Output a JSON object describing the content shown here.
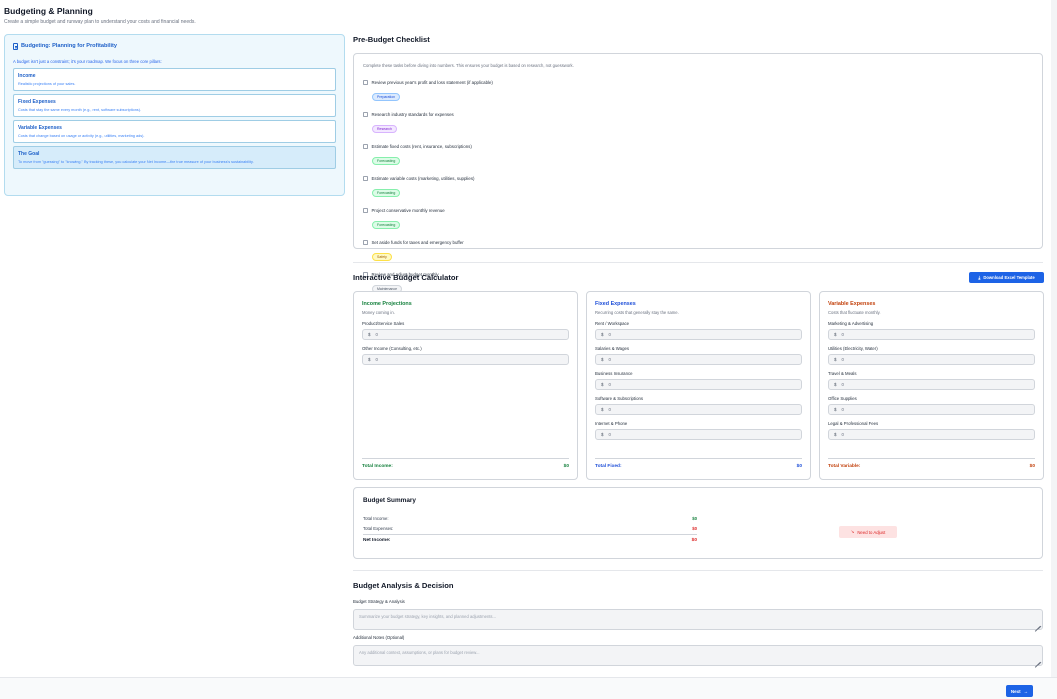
{
  "header": {
    "title": "Budgeting & Planning",
    "subtitle": "Create a simple budget and runway plan to understand your costs and financial needs."
  },
  "intro_panel": {
    "title": "Budgeting: Planning for Profitability",
    "intro": "A budget isn't just a constraint; it's your roadmap. We focus on three core pillars:",
    "pillars": [
      {
        "title": "Income",
        "desc": "Realistic projections of your sales."
      },
      {
        "title": "Fixed Expenses",
        "desc": "Costs that stay the same every month (e.g., rent, software subscriptions)."
      },
      {
        "title": "Variable Expenses",
        "desc": "Costs that change based on usage or activity (e.g., utilities, marketing ads)."
      },
      {
        "title": "The Goal",
        "desc": "To move from \"guessing\" to \"knowing.\" By tracking these, you calculate your Net Income—the true measure of your business's sustainability."
      }
    ]
  },
  "checklist": {
    "title": "Pre-Budget Checklist",
    "intro": "Complete these tasks before diving into numbers. This ensures your budget is based on research, not guesswork.",
    "items": [
      {
        "text": "Review previous year's profit and loss statement (if applicable)",
        "tag": "Preparation",
        "tag_style": "b-prep"
      },
      {
        "text": "Research industry standards for expenses",
        "tag": "Research",
        "tag_style": "b-research"
      },
      {
        "text": "Estimate fixed costs (rent, insurance, subscriptions)",
        "tag": "Forecasting",
        "tag_style": "b-forecast"
      },
      {
        "text": "Estimate variable costs (marketing, utilities, supplies)",
        "tag": "Forecasting",
        "tag_style": "b-forecast"
      },
      {
        "text": "Project conservative monthly revenue",
        "tag": "Forecasting",
        "tag_style": "b-forecast"
      },
      {
        "text": "Set aside funds for taxes and emergency buffer",
        "tag": "Safety",
        "tag_style": "b-safety"
      },
      {
        "text": "Review and adjust budget monthly",
        "tag": "Maintenance",
        "tag_style": "b-maint"
      }
    ]
  },
  "calculator": {
    "title": "Interactive Budget Calculator",
    "download_label": "Download Excel Template",
    "currency": "$",
    "placeholder": "0",
    "columns": [
      {
        "key": "income",
        "title": "Income Projections",
        "subtitle": "Money coming in.",
        "color_class": "green",
        "fields": [
          "Product/Service Sales",
          "Other Income (Consulting, etc.)"
        ],
        "total_label": "Total Income:",
        "total": "$0"
      },
      {
        "key": "fixed",
        "title": "Fixed Expenses",
        "subtitle": "Recurring costs that generally stay the same.",
        "color_class": "blue",
        "fields": [
          "Rent / Workspace",
          "Salaries & Wages",
          "Business Insurance",
          "Software & Subscriptions",
          "Internet & Phone"
        ],
        "total_label": "Total Fixed:",
        "total": "$0"
      },
      {
        "key": "variable",
        "title": "Variable Expenses",
        "subtitle": "Costs that fluctuate monthly.",
        "color_class": "orange",
        "fields": [
          "Marketing & Advertising",
          "Utilities (Electricity, Water)",
          "Travel & Meals",
          "Office Supplies",
          "Legal & Professional Fees"
        ],
        "total_label": "Total Variable:",
        "total": "$0"
      }
    ]
  },
  "summary": {
    "title": "Budget Summary",
    "total_income_label": "Total Income:",
    "total_income": "$0",
    "total_expenses_label": "Total Expenses:",
    "total_expenses": "$0",
    "net_income_label": "Net Income:",
    "net_income": "$0",
    "status": "Need to Adjust"
  },
  "analysis": {
    "title": "Budget Analysis & Decision",
    "strategy_label": "Budget Strategy & Analysis",
    "strategy_placeholder": "Summarize your budget strategy, key insights, and planned adjustments...",
    "notes_label": "Additional Notes (Optional)",
    "notes_placeholder": "Any additional context, assumptions, or plans for budget review..."
  },
  "footer": {
    "next_label": "Next"
  }
}
